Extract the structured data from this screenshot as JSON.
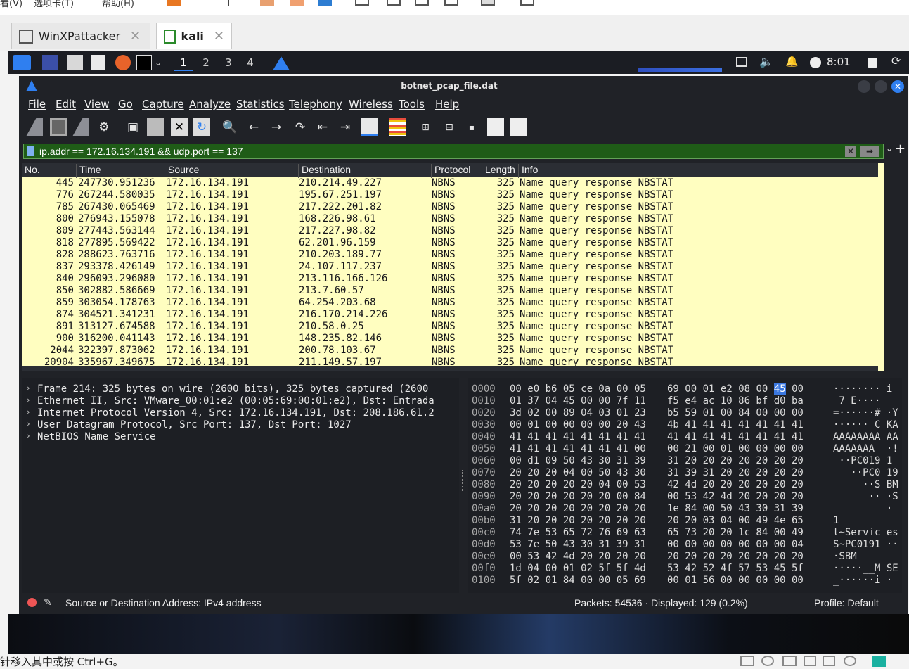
{
  "host": {
    "menu_partial": [
      "看(V)",
      "选项卡(T)",
      "帮助(H)"
    ],
    "status_hint": "针移入其中或按 Ctrl+G。"
  },
  "vm_tabs": [
    {
      "label": "WinXPattacker",
      "active": false
    },
    {
      "label": "kali",
      "active": true
    }
  ],
  "kali_panel": {
    "workspaces": [
      "1",
      "2",
      "3",
      "4"
    ],
    "active_workspace": "1",
    "clock": "8:01"
  },
  "wireshark": {
    "window_title": "botnet_pcap_file.dat",
    "menu": [
      "File",
      "Edit",
      "View",
      "Go",
      "Capture",
      "Analyze",
      "Statistics",
      "Telephony",
      "Wireless",
      "Tools",
      "Help"
    ],
    "filter": "ip.addr == 172.16.134.191 && udp.port == 137",
    "columns": [
      "No.",
      "Time",
      "Source",
      "Destination",
      "Protocol",
      "Length",
      "Info"
    ],
    "packets": [
      {
        "no": "445",
        "time": "247730.951236",
        "src": "172.16.134.191",
        "dst": "210.214.49.227",
        "proto": "NBNS",
        "len": "325",
        "info": "Name query response NBSTAT"
      },
      {
        "no": "776",
        "time": "267244.580035",
        "src": "172.16.134.191",
        "dst": "195.67.251.197",
        "proto": "NBNS",
        "len": "325",
        "info": "Name query response NBSTAT"
      },
      {
        "no": "785",
        "time": "267430.065469",
        "src": "172.16.134.191",
        "dst": "217.222.201.82",
        "proto": "NBNS",
        "len": "325",
        "info": "Name query response NBSTAT"
      },
      {
        "no": "800",
        "time": "276943.155078",
        "src": "172.16.134.191",
        "dst": "168.226.98.61",
        "proto": "NBNS",
        "len": "325",
        "info": "Name query response NBSTAT"
      },
      {
        "no": "809",
        "time": "277443.563144",
        "src": "172.16.134.191",
        "dst": "217.227.98.82",
        "proto": "NBNS",
        "len": "325",
        "info": "Name query response NBSTAT"
      },
      {
        "no": "818",
        "time": "277895.569422",
        "src": "172.16.134.191",
        "dst": "62.201.96.159",
        "proto": "NBNS",
        "len": "325",
        "info": "Name query response NBSTAT"
      },
      {
        "no": "828",
        "time": "288623.763716",
        "src": "172.16.134.191",
        "dst": "210.203.189.77",
        "proto": "NBNS",
        "len": "325",
        "info": "Name query response NBSTAT"
      },
      {
        "no": "837",
        "time": "293378.426149",
        "src": "172.16.134.191",
        "dst": "24.107.117.237",
        "proto": "NBNS",
        "len": "325",
        "info": "Name query response NBSTAT"
      },
      {
        "no": "840",
        "time": "296093.296080",
        "src": "172.16.134.191",
        "dst": "213.116.166.126",
        "proto": "NBNS",
        "len": "325",
        "info": "Name query response NBSTAT"
      },
      {
        "no": "850",
        "time": "302882.586669",
        "src": "172.16.134.191",
        "dst": "213.7.60.57",
        "proto": "NBNS",
        "len": "325",
        "info": "Name query response NBSTAT"
      },
      {
        "no": "859",
        "time": "303054.178763",
        "src": "172.16.134.191",
        "dst": "64.254.203.68",
        "proto": "NBNS",
        "len": "325",
        "info": "Name query response NBSTAT"
      },
      {
        "no": "874",
        "time": "304521.341231",
        "src": "172.16.134.191",
        "dst": "216.170.214.226",
        "proto": "NBNS",
        "len": "325",
        "info": "Name query response NBSTAT"
      },
      {
        "no": "891",
        "time": "313127.674588",
        "src": "172.16.134.191",
        "dst": "210.58.0.25",
        "proto": "NBNS",
        "len": "325",
        "info": "Name query response NBSTAT"
      },
      {
        "no": "900",
        "time": "316200.041143",
        "src": "172.16.134.191",
        "dst": "148.235.82.146",
        "proto": "NBNS",
        "len": "325",
        "info": "Name query response NBSTAT"
      },
      {
        "no": "2044",
        "time": "322397.873062",
        "src": "172.16.134.191",
        "dst": "200.78.103.67",
        "proto": "NBNS",
        "len": "325",
        "info": "Name query response NBSTAT"
      },
      {
        "no": "20904",
        "time": "335967.349675",
        "src": "172.16.134.191",
        "dst": "211.149.57.197",
        "proto": "NBNS",
        "len": "325",
        "info": "Name query response NBSTAT"
      }
    ],
    "details": [
      "Frame 214: 325 bytes on wire (2600 bits), 325 bytes captured (2600",
      "Ethernet II, Src: VMware_00:01:e2 (00:05:69:00:01:e2), Dst: Entrada",
      "Internet Protocol Version 4, Src: 172.16.134.191, Dst: 208.186.61.2",
      "User Datagram Protocol, Src Port: 137, Dst Port: 1027",
      "NetBIOS Name Service"
    ],
    "bytes": [
      {
        "off": "0000",
        "h1": "00 e0 b6 05 ce 0a 00 05",
        "h2": "69 00 01 e2 08 00 45 00",
        "ascii": "········ i"
      },
      {
        "off": "0010",
        "h1": "01 37 04 45 00 00 7f 11",
        "h2": "f5 e4 ac 10 86 bf d0 ba",
        "ascii": " 7 E····"
      },
      {
        "off": "0020",
        "h1": "3d 02 00 89 04 03 01 23",
        "h2": "b5 59 01 00 84 00 00 00",
        "ascii": "=······# ·Y"
      },
      {
        "off": "0030",
        "h1": "00 01 00 00 00 00 20 43",
        "h2": "4b 41 41 41 41 41 41 41",
        "ascii": "······ C KA"
      },
      {
        "off": "0040",
        "h1": "41 41 41 41 41 41 41 41",
        "h2": "41 41 41 41 41 41 41 41",
        "ascii": "AAAAAAAA AA"
      },
      {
        "off": "0050",
        "h1": "41 41 41 41 41 41 41 00",
        "h2": "00 21 00 01 00 00 00 00",
        "ascii": "AAAAAAA  ·!"
      },
      {
        "off": "0060",
        "h1": "00 d1 09 50 43 30 31 39",
        "h2": "31 20 20 20 20 20 20 20",
        "ascii": " ··PC019 1"
      },
      {
        "off": "0070",
        "h1": "20 20 20 04 00 50 43 30",
        "h2": "31 39 31 20 20 20 20 20",
        "ascii": "   ··PC0 19"
      },
      {
        "off": "0080",
        "h1": "20 20 20 20 20 04 00 53",
        "h2": "42 4d 20 20 20 20 20 20",
        "ascii": "     ··S BM"
      },
      {
        "off": "0090",
        "h1": "20 20 20 20 20 20 00 84",
        "h2": "00 53 42 4d 20 20 20 20",
        "ascii": "      ·· ·S"
      },
      {
        "off": "00a0",
        "h1": "20 20 20 20 20 20 20 20",
        "h2": "1e 84 00 50 43 30 31 39",
        "ascii": "         ·"
      },
      {
        "off": "00b0",
        "h1": "31 20 20 20 20 20 20 20",
        "h2": "20 20 03 04 00 49 4e 65",
        "ascii": "1"
      },
      {
        "off": "00c0",
        "h1": "74 7e 53 65 72 76 69 63",
        "h2": "65 73 20 20 1c 84 00 49",
        "ascii": "t~Servic es"
      },
      {
        "off": "00d0",
        "h1": "53 7e 50 43 30 31 39 31",
        "h2": "00 00 00 00 00 00 00 04",
        "ascii": "S~PC0191 ··"
      },
      {
        "off": "00e0",
        "h1": "00 53 42 4d 20 20 20 20",
        "h2": "20 20 20 20 20 20 20 20",
        "ascii": "·SBM"
      },
      {
        "off": "00f0",
        "h1": "1d 04 00 01 02 5f 5f 4d",
        "h2": "53 42 52 4f 57 53 45 5f",
        "ascii": "·····__M SE"
      },
      {
        "off": "0100",
        "h1": "5f 02 01 84 00 00 05 69",
        "h2": "00 01 56 00 00 00 00 00",
        "ascii": "_······i ·"
      }
    ],
    "highlight_byte": "45",
    "status": {
      "field": "Source or Destination Address: IPv4 address",
      "packets": "Packets: 54536 · Displayed: 129 (0.2%)",
      "profile": "Profile: Default"
    }
  },
  "colors": {
    "filter_bg": "#1f5c17",
    "row_bg": "#fffec0",
    "accent": "#2f7ff0"
  }
}
